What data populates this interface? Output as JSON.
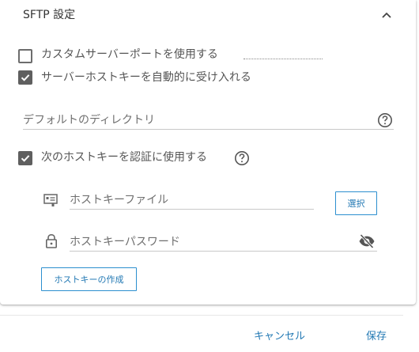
{
  "section": {
    "title": "SFTP 設定",
    "collapse_icon": "chevron-up-icon"
  },
  "options": {
    "custom_port": {
      "label": "カスタムサーバーポートを使用する",
      "checked": false,
      "value": ""
    },
    "auto_accept_host_key": {
      "label": "サーバーホストキーを自動的に受け入れる",
      "checked": true
    },
    "use_host_key": {
      "label": "次のホストキーを認証に使用する",
      "checked": true
    }
  },
  "default_directory": {
    "placeholder": "デフォルトのディレクトリ",
    "value": ""
  },
  "host_key_file": {
    "placeholder": "ホストキーファイル",
    "value": "",
    "icon": "key-file-icon",
    "select_button": "選択"
  },
  "host_key_password": {
    "placeholder": "ホストキーパスワード",
    "value": "",
    "icon": "lock-icon",
    "visibility_icon": "eye-off-icon"
  },
  "create_host_key_button": "ホストキーの作成",
  "footer": {
    "cancel": "キャンセル",
    "save": "保存"
  },
  "colors": {
    "accent": "#2379b4",
    "checkbox": "#5f5f5f"
  }
}
